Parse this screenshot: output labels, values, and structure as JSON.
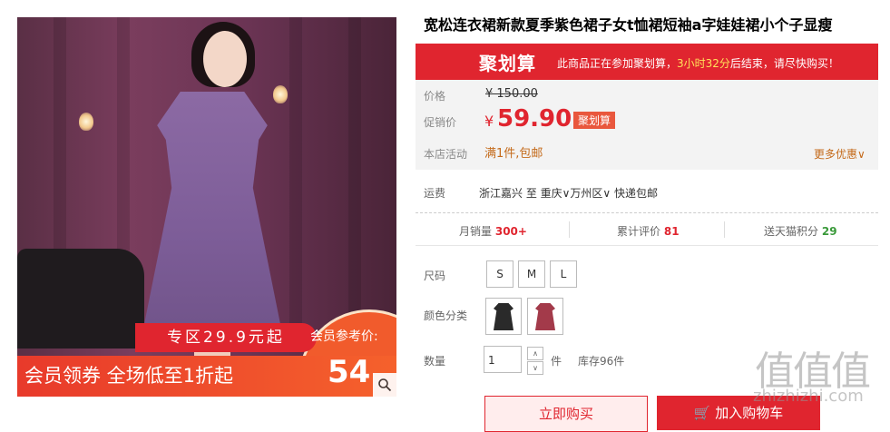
{
  "product": {
    "title": "宽松连衣裙新款夏季紫色裙子女t恤裙短袖a字娃娃裙小个子显瘦"
  },
  "image": {
    "zone_banner": "专区29.9元起",
    "coupon_text": "会员领券 全场低至1折起",
    "member_label": "会员参考价:",
    "member_price": "54",
    "zoom_icon": "magnifier-icon"
  },
  "juhuasuan": {
    "logo": "聚划算",
    "msg_before": "此商品正在参加聚划算，",
    "msg_time": "3小时32分",
    "msg_after": "后结束，请尽快购买！"
  },
  "price": {
    "orig_label": "价格",
    "orig": "¥ 150.00",
    "promo_label": "促销价",
    "currency": "¥",
    "promo": "59.90",
    "tag": "聚划算",
    "activity_label": "本店活动",
    "activity": "满1件,包邮",
    "more": "更多优惠"
  },
  "shipping": {
    "label": "运费",
    "text": "浙江嘉兴 至 重庆∨万州区∨ 快递包邮"
  },
  "stats": {
    "sales_label": "月销量",
    "sales": "300+",
    "reviews_label": "累计评价",
    "reviews": "81",
    "points_label": "送天猫积分",
    "points": "29"
  },
  "size": {
    "label": "尺码",
    "options": [
      "S",
      "M",
      "L"
    ]
  },
  "color": {
    "label": "颜色分类"
  },
  "quantity": {
    "label": "数量",
    "value": "1",
    "unit": "件",
    "stock": "库存96件"
  },
  "actions": {
    "buy": "立即购买",
    "cart": "加入购物车"
  },
  "watermark": {
    "logo": "值值值",
    "site": "zhizhizhi.com"
  },
  "colors": {
    "accent": "#e0252f",
    "activity": "#c46a1a",
    "points": "#3a9a3a"
  }
}
